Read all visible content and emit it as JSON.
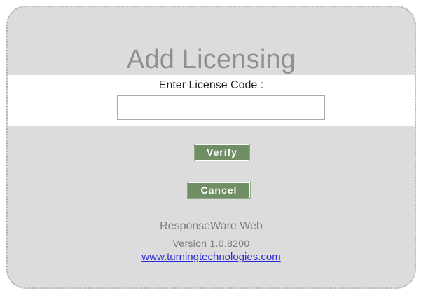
{
  "dialog": {
    "title": "Add Licensing",
    "license_label": "Enter License Code :",
    "license_value": "",
    "verify_label": "Verify",
    "cancel_label": "Cancel"
  },
  "footer": {
    "product": "ResponseWare Web",
    "version": "Version 1.0.8200",
    "link_text": "www.turningtechnologies.com"
  },
  "colors": {
    "panel": "#dcdcdc",
    "button": "#6f8e63",
    "link": "#2a2ad6",
    "title": "#8f8f8f"
  }
}
